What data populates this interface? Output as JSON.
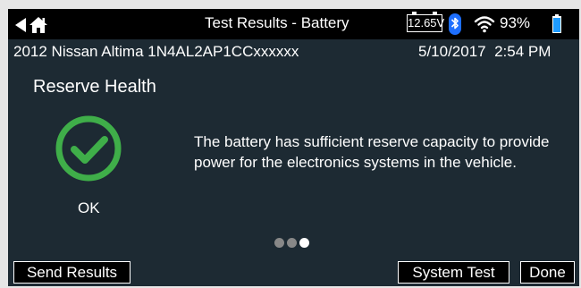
{
  "header": {
    "title": "Test Results - Battery",
    "voltage": "12.65V",
    "battery_percent": "93%",
    "icons": [
      "back-icon",
      "home-icon",
      "bluetooth-icon",
      "wifi-icon",
      "battery-icon"
    ]
  },
  "vehicle": {
    "description": "2012 Nissan Altima 1N4AL2AP1CCxxxxxx",
    "date": "5/10/2017",
    "time": "2:54 PM"
  },
  "result": {
    "section_title": "Reserve Health",
    "status": "OK",
    "message": "The battery has sufficient reserve capacity to provide power for the electronics systems in the vehicle.",
    "status_icon": "check-circle-icon"
  },
  "pagination": {
    "total": 3,
    "current": 3
  },
  "buttons": {
    "send_results": "Send Results",
    "system_test": "System Test",
    "done": "Done"
  },
  "colors": {
    "background": "#1d2a33",
    "topbar": "#000000",
    "success": "#3fae49",
    "battery_fill": "#1e9bff",
    "bluetooth": "#1e6fff"
  }
}
